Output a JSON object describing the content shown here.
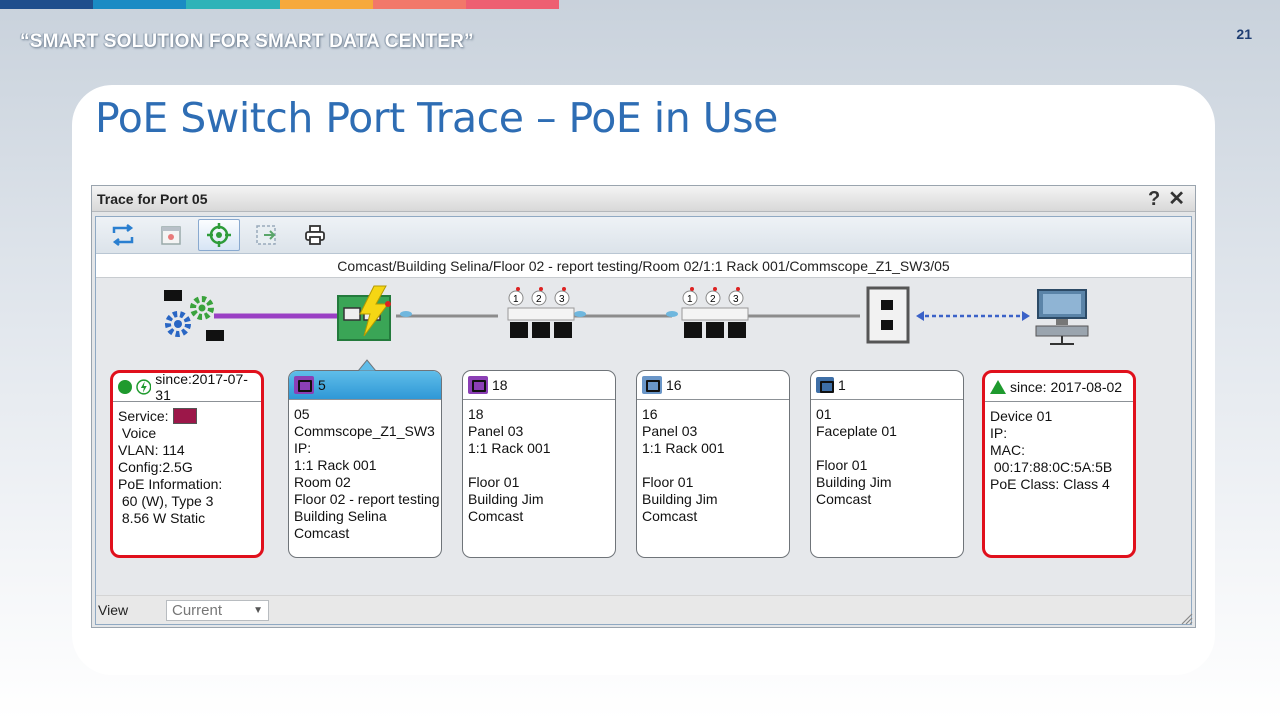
{
  "colors": {
    "accent_title": "#2e6db4",
    "service_voice": "#9c1749",
    "highlight_border": "#e0101c",
    "selected_header": "#2f98d6"
  },
  "topbar_colors": [
    "#1f4e8c",
    "#1a8bc4",
    "#2fb3b8",
    "#f6a93b",
    "#f2786a",
    "#ee5f72"
  ],
  "slide": {
    "slogan": "“SMART SOLUTION FOR SMART DATA CENTER”",
    "page_number": "21",
    "title": "PoE Switch Port Trace – PoE in Use"
  },
  "window": {
    "title": "Trace for Port 05",
    "help_icon": "?",
    "close_icon": "✕",
    "toolbar": [
      "refresh-icon",
      "calendar-icon",
      "locate-icon",
      "export-icon",
      "print-icon"
    ],
    "breadcrumb": "Comcast/Building Selina/Floor 02 - report testing/Room 02/1:1 Rack 001/Commscope_Z1_SW3/05",
    "view_label": "View",
    "view_value": "Current"
  },
  "trace": {
    "devices": [
      "endpoint-service-icon",
      "poe-switch-icon",
      "patch-panel-icon",
      "patch-panel-icon",
      "faceplate-icon",
      "computer-icon"
    ],
    "panel_port_labels": [
      "①",
      "②",
      "③"
    ]
  },
  "cards": [
    {
      "header": "since:2017-07-31",
      "lines": [
        "Service:",
        " Voice",
        "VLAN: 114",
        "Config:2.5G",
        "PoE Information:",
        " 60 (W), Type 3",
        " 8.56 W Static"
      ]
    },
    {
      "header": "5",
      "lines": [
        "05",
        "Commscope_Z1_SW3",
        "IP:",
        "1:1 Rack 001",
        "Room 02",
        "Floor 02 - report testing",
        "Building Selina",
        "Comcast"
      ]
    },
    {
      "header": "18",
      "lines": [
        "18",
        "Panel 03",
        "1:1 Rack 001",
        "",
        "Floor 01",
        "Building Jim",
        "Comcast"
      ]
    },
    {
      "header": "16",
      "lines": [
        "16",
        "Panel 03",
        "1:1 Rack 001",
        "",
        "Floor 01",
        "Building Jim",
        "Comcast"
      ]
    },
    {
      "header": "1",
      "lines": [
        "01",
        "Faceplate 01",
        "",
        "Floor 01",
        "Building Jim",
        "Comcast"
      ]
    },
    {
      "header": "since: 2017-08-02",
      "lines": [
        "Device 01",
        "IP:",
        "MAC:",
        " 00:17:88:0C:5A:5B",
        "PoE Class: Class 4"
      ]
    }
  ]
}
